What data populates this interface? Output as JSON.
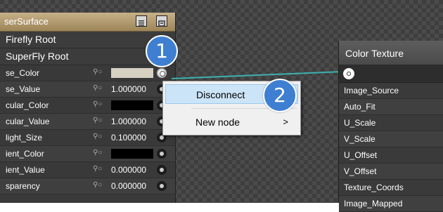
{
  "left_node": {
    "title": "serSurface",
    "root1": "Firefly Root",
    "root2": "SuperFly Root",
    "params": [
      {
        "name": "se_Color",
        "value": ""
      },
      {
        "name": "se_Value",
        "value": "1.000000"
      },
      {
        "name": "cular_Color",
        "value": ""
      },
      {
        "name": "cular_Value",
        "value": "1.000000"
      },
      {
        "name": "light_Size",
        "value": "0.100000"
      },
      {
        "name": "ient_Color",
        "value": ""
      },
      {
        "name": "ient_Value",
        "value": "0.000000"
      },
      {
        "name": "sparency",
        "value": "0.000000"
      }
    ],
    "link_glyph": "⚲○"
  },
  "right_node": {
    "title": "Color Texture",
    "inputs": [
      "Image_Source",
      "Auto_Fit",
      "U_Scale",
      "V_Scale",
      "U_Offset",
      "V_Offset",
      "Texture_Coords",
      "Image_Mapped"
    ]
  },
  "context_menu": {
    "items": [
      {
        "label": "Disconnect",
        "highlighted": true
      },
      {
        "label": "New node",
        "submenu_arrow": ">"
      }
    ]
  },
  "badges": {
    "step1": "1",
    "step2": "2"
  },
  "colors": {
    "wire": "#3fb0b0",
    "badge": "#3f7fd1",
    "menu_highlight": "#cce4f7"
  }
}
